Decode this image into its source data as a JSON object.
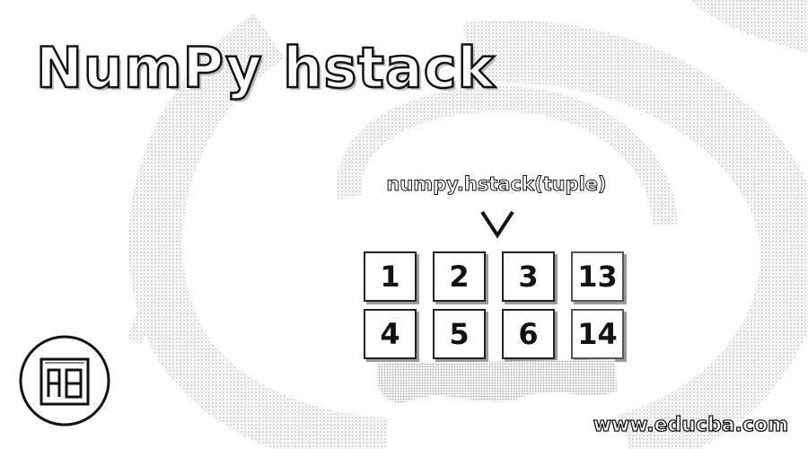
{
  "title": "NumPy hstack",
  "syntax_text": "numpy.hstack(tuple)",
  "chevron_icon": "chevron-down-icon",
  "grid": {
    "rows": [
      [
        "1",
        "2",
        "3",
        "13"
      ],
      [
        "4",
        "5",
        "6",
        "14"
      ]
    ]
  },
  "logo_icon": "educba-logo-icon",
  "website": "www.educba.com"
}
